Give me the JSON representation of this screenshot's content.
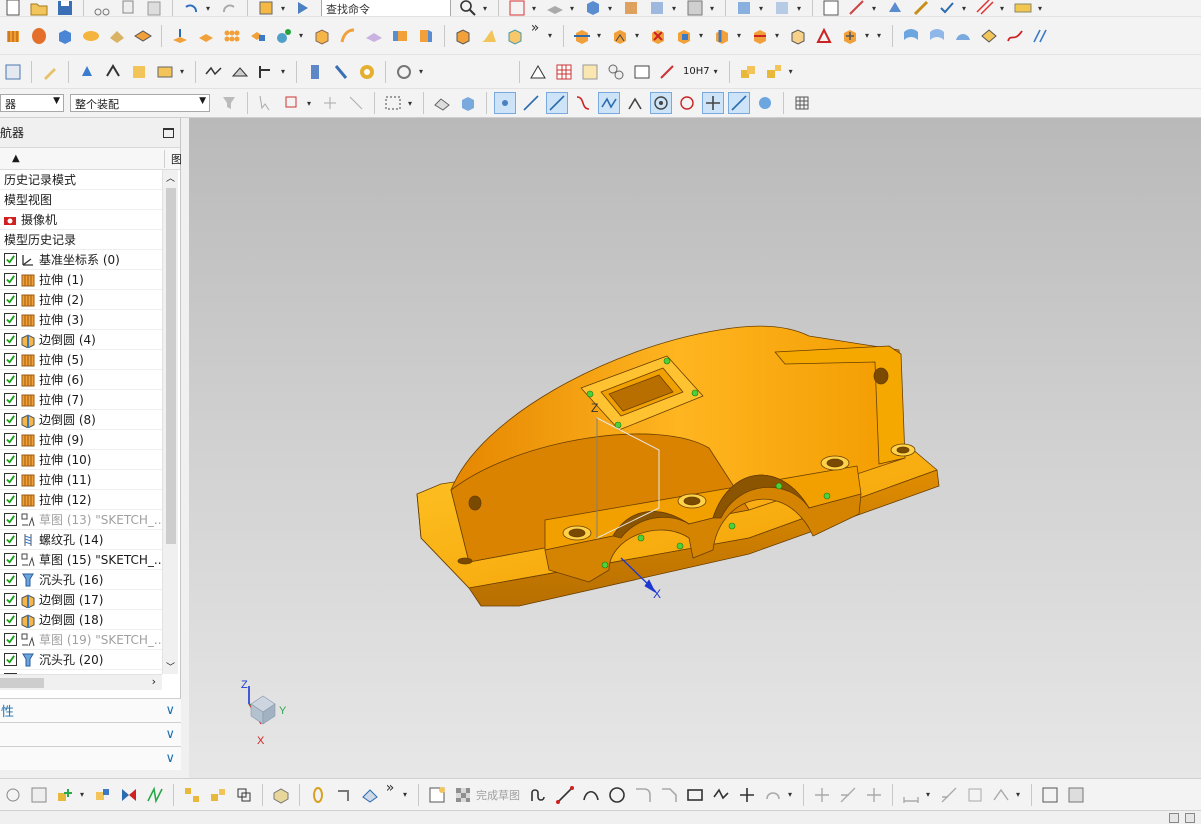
{
  "toolbar": {
    "find_command_placeholder": "查找命令",
    "filter_select": "器",
    "assembly_select": "整个装配",
    "more_glyph": "»",
    "fit_label": "10H7",
    "finish_sketch_label": "完成草图"
  },
  "navigator": {
    "title": "导航器",
    "sort_glyph": "▲",
    "col_clip": "图",
    "items": [
      {
        "label": "历史记录模式",
        "type": "mode"
      },
      {
        "label": "模型视图",
        "type": "mode"
      },
      {
        "label": "摄像机",
        "type": "camera"
      },
      {
        "label": "模型历史记录",
        "type": "mode"
      },
      {
        "label": "基准坐标系 (0)",
        "type": "datum",
        "checked": true
      },
      {
        "label": "拉伸 (1)",
        "type": "extrude",
        "checked": true
      },
      {
        "label": "拉伸 (2)",
        "type": "extrude",
        "checked": true
      },
      {
        "label": "拉伸 (3)",
        "type": "extrude",
        "checked": true
      },
      {
        "label": "边倒圆 (4)",
        "type": "blend",
        "checked": true
      },
      {
        "label": "拉伸 (5)",
        "type": "extrude",
        "checked": true
      },
      {
        "label": "拉伸 (6)",
        "type": "extrude",
        "checked": true
      },
      {
        "label": "拉伸 (7)",
        "type": "extrude",
        "checked": true
      },
      {
        "label": "边倒圆 (8)",
        "type": "blend",
        "checked": true
      },
      {
        "label": "拉伸 (9)",
        "type": "extrude",
        "checked": true
      },
      {
        "label": "拉伸 (10)",
        "type": "extrude",
        "checked": true
      },
      {
        "label": "拉伸 (11)",
        "type": "extrude",
        "checked": true
      },
      {
        "label": "拉伸 (12)",
        "type": "extrude",
        "checked": true
      },
      {
        "label": "草图 (13) \"SKETCH_...",
        "type": "sketch",
        "checked": true,
        "dim": true
      },
      {
        "label": "螺纹孔 (14)",
        "type": "thread",
        "checked": true
      },
      {
        "label": "草图 (15) \"SKETCH_...",
        "type": "sketch",
        "checked": true
      },
      {
        "label": "沉头孔 (16)",
        "type": "hole",
        "checked": true
      },
      {
        "label": "边倒圆 (17)",
        "type": "blend",
        "checked": true
      },
      {
        "label": "边倒圆 (18)",
        "type": "blend",
        "checked": true
      },
      {
        "label": "草图 (19) \"SKETCH_...",
        "type": "sketch",
        "checked": true,
        "dim": true
      },
      {
        "label": "沉头孔 (20)",
        "type": "hole",
        "checked": true
      },
      {
        "label": "",
        "type": "datum",
        "checked": true
      }
    ],
    "panels": [
      {
        "label": "属性"
      },
      {
        "label": ""
      },
      {
        "label": ""
      }
    ]
  },
  "viewport": {
    "triad": {
      "z": "Z",
      "y": "Y",
      "x": "X"
    },
    "part_color": "#f5a800",
    "wcs": {
      "z": "Z",
      "x": "X"
    }
  },
  "colors": {
    "accent_blue": "#1a6fb3",
    "part_orange": "#f5a800",
    "part_dark": "#c77f00",
    "check_green": "#15a015"
  }
}
